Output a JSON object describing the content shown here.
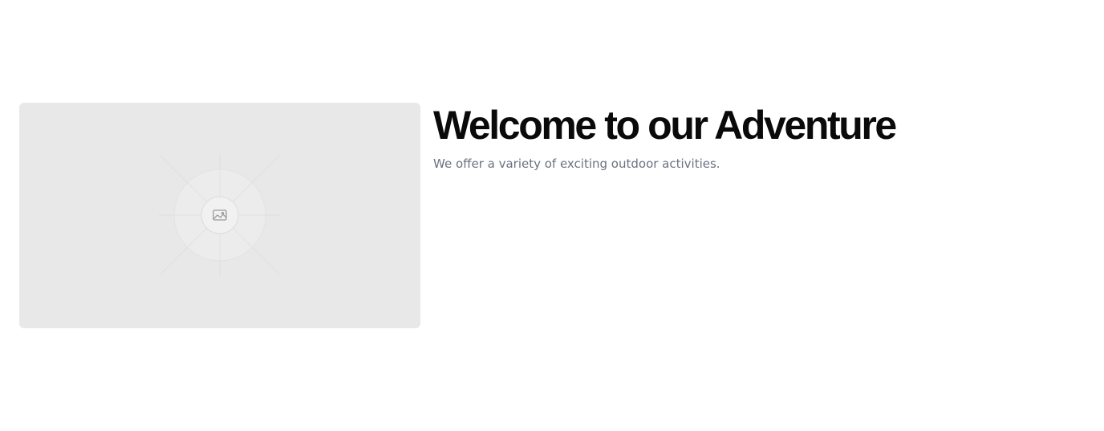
{
  "hero": {
    "image_icon": "image-icon",
    "title": "Welcome to our Adventure",
    "subtitle": "We offer a variety of exciting outdoor activities."
  },
  "colors": {
    "background": "#ffffff",
    "placeholder_bg": "#e8e8e8",
    "title": "#0a0a0a",
    "subtitle": "#6b7280"
  }
}
